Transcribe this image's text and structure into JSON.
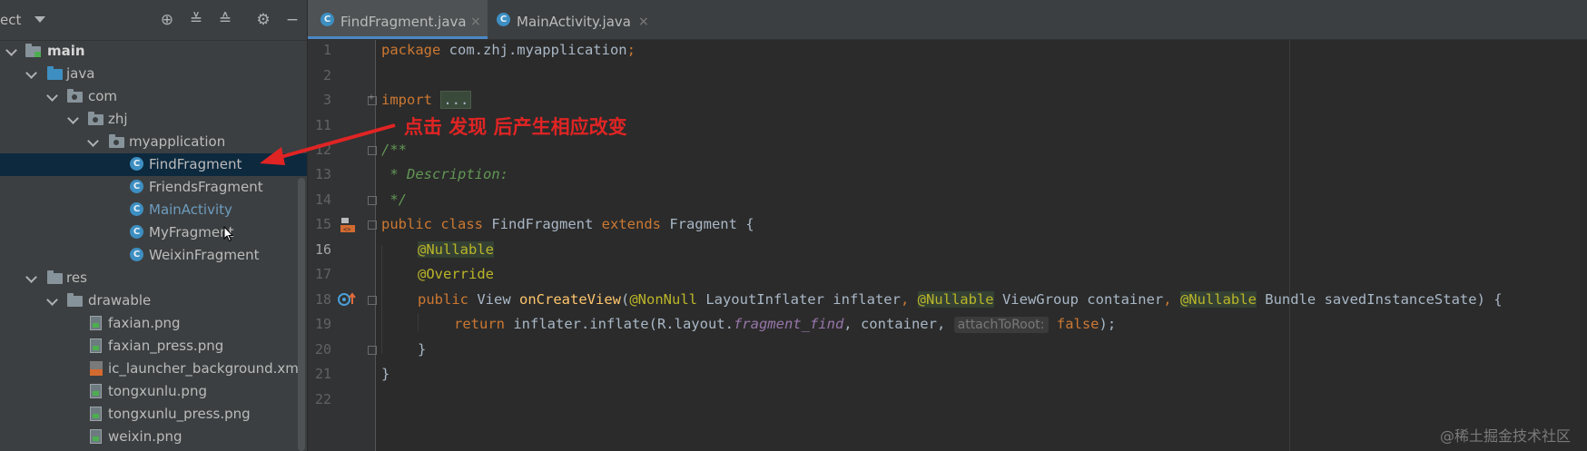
{
  "project_panel": {
    "title": "ect",
    "tree": [
      {
        "label": "main",
        "kind": "module",
        "depth": 0
      },
      {
        "label": "java",
        "kind": "folder-blue",
        "depth": 1
      },
      {
        "label": "com",
        "kind": "package",
        "depth": 2
      },
      {
        "label": "zhj",
        "kind": "package",
        "depth": 3
      },
      {
        "label": "myapplication",
        "kind": "package",
        "depth": 4
      },
      {
        "label": "FindFragment",
        "kind": "class",
        "depth": 5,
        "selected": true
      },
      {
        "label": "FriendsFragment",
        "kind": "class",
        "depth": 5
      },
      {
        "label": "MainActivity",
        "kind": "class",
        "depth": 5,
        "modified": true
      },
      {
        "label": "MyFragment",
        "kind": "class",
        "depth": 5
      },
      {
        "label": "WeixinFragment",
        "kind": "class",
        "depth": 5
      },
      {
        "label": "res",
        "kind": "folder",
        "depth": 1
      },
      {
        "label": "drawable",
        "kind": "folder",
        "depth": 2
      },
      {
        "label": "faxian.png",
        "kind": "image",
        "depth": 3
      },
      {
        "label": "faxian_press.png",
        "kind": "image",
        "depth": 3
      },
      {
        "label": "ic_launcher_background.xm",
        "kind": "xml",
        "depth": 3
      },
      {
        "label": "tongxunlu.png",
        "kind": "image",
        "depth": 3
      },
      {
        "label": "tongxunlu_press.png",
        "kind": "image",
        "depth": 3
      },
      {
        "label": "weixin.png",
        "kind": "image",
        "depth": 3
      }
    ]
  },
  "tabs": [
    {
      "label": "FindFragment.java",
      "active": true,
      "close": "×"
    },
    {
      "label": "MainActivity.java",
      "active": false,
      "close": "×"
    }
  ],
  "editor": {
    "line_numbers": [
      "1",
      "2",
      "3",
      "11",
      "12",
      "13",
      "14",
      "15",
      "16",
      "17",
      "18",
      "19",
      "20",
      "21",
      "22"
    ],
    "current_line": "16",
    "code": {
      "l1_kw": "package ",
      "l1_pkg": "com.zhj.myapplication",
      "l1_semi": ";",
      "l3_kw": "import ",
      "l3_fold": "...",
      "l12": "/**",
      "l13": " * Description:",
      "l14": " */",
      "l15_kw1": "public class ",
      "l15_name": "FindFragment ",
      "l15_kw2": "extends ",
      "l15_rest": "Fragment {",
      "l16": "@Nullable",
      "l17": "@Override",
      "l18_kw": "public ",
      "l18_type": "View ",
      "l18_fn": "onCreateView",
      "l18_p1": "(",
      "l18_ann1": "@NonNull",
      "l18_t1": " LayoutInflater inflater",
      "l18_c1": ", ",
      "l18_ann2": "@Nullable",
      "l18_t2": " ViewGroup container",
      "l18_c2": ", ",
      "l18_ann3": "@Nullable",
      "l18_t3": " Bundle savedInstanceState) {",
      "l19_kw": "return ",
      "l19_a": "inflater.inflate(R.layout.",
      "l19_field": "fragment_find",
      "l19_b": ", container, ",
      "l19_hint": "attachToRoot:",
      "l19_val": "false",
      "l19_end": ");",
      "l20": "}",
      "l21": "}"
    }
  },
  "annotation": "点击 发现 后产生相应改变",
  "watermark": "@稀土掘金技术社区",
  "colors": {
    "accent_red": "#e02424",
    "selection": "#0d293e",
    "tab_underline": "#4a88c7"
  }
}
